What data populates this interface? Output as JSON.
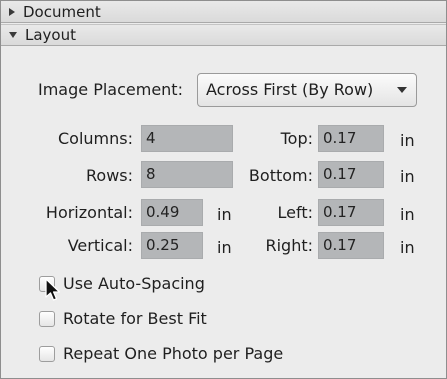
{
  "sections": {
    "document": {
      "label": "Document"
    },
    "layout": {
      "label": "Layout"
    }
  },
  "image_placement": {
    "label": "Image Placement:",
    "selected": "Across First (By Row)"
  },
  "fields": {
    "columns": {
      "label": "Columns:",
      "value": "4"
    },
    "rows": {
      "label": "Rows:",
      "value": "8"
    },
    "horizontal": {
      "label": "Horizontal:",
      "value": "0.49",
      "unit": "in"
    },
    "vertical": {
      "label": "Vertical:",
      "value": "0.25",
      "unit": "in"
    },
    "top": {
      "label": "Top:",
      "value": "0.17",
      "unit": "in"
    },
    "bottom": {
      "label": "Bottom:",
      "value": "0.17",
      "unit": "in"
    },
    "left": {
      "label": "Left:",
      "value": "0.17",
      "unit": "in"
    },
    "right": {
      "label": "Right:",
      "value": "0.17",
      "unit": "in"
    }
  },
  "checkboxes": {
    "auto_spacing": {
      "label": "Use Auto-Spacing",
      "checked": false
    },
    "rotate_best_fit": {
      "label": "Rotate for Best Fit",
      "checked": false
    },
    "repeat_one_photo": {
      "label": "Repeat One Photo per Page",
      "checked": false
    }
  },
  "icons": {
    "collapsed": "disclosure-triangle-right-icon",
    "expanded": "disclosure-triangle-down-icon",
    "dropdown": "dropdown-arrow-icon",
    "cursor": "mouse-pointer-icon"
  }
}
